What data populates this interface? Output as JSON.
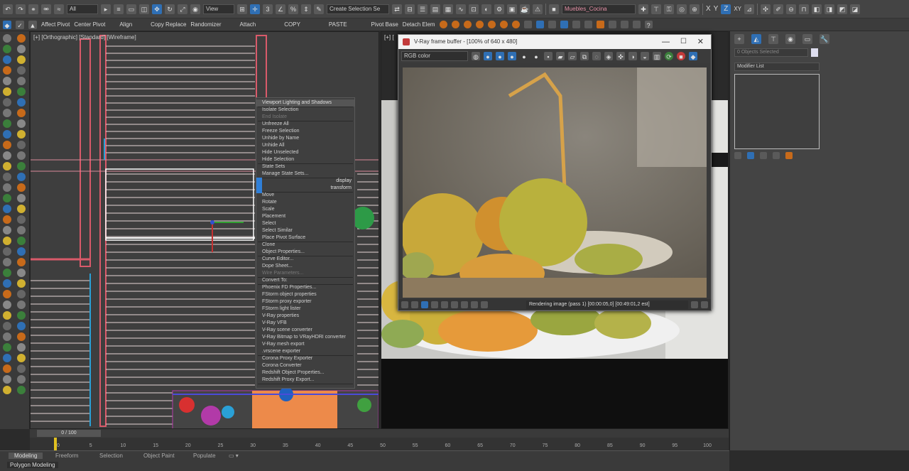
{
  "toolbar": {
    "filter_value": "All",
    "view_value": "View",
    "selection_set_placeholder": "Create Selection Se",
    "object_name": "Muebles_Cocina",
    "axis_labels": [
      "X",
      "Y",
      "Z",
      "XY"
    ]
  },
  "toolbar2": {
    "items": [
      "Affect Pivot",
      "Center Pivot",
      "Align",
      "Copy Replace",
      "Randomizer",
      "Attach",
      "COPY",
      "PASTE",
      "Pivot Base",
      "Detach Elem"
    ]
  },
  "viewport_left": {
    "label": "[+] [Orthographic] [Standard] [Wireframe]"
  },
  "viewport_right": {
    "label": "[+] ["
  },
  "quad_menu": {
    "items": [
      {
        "label": "Viewport Lighting and Shadows",
        "type": "head"
      },
      {
        "label": "Isolate Selection",
        "type": "item"
      },
      {
        "label": "End Isolate",
        "type": "dim"
      },
      {
        "label": "Unfreeze All",
        "type": "item"
      },
      {
        "label": "Freeze Selection",
        "type": "item"
      },
      {
        "label": "Unhide by Name",
        "type": "item"
      },
      {
        "label": "Unhide All",
        "type": "item"
      },
      {
        "label": "Hide Unselected",
        "type": "item"
      },
      {
        "label": "Hide Selection",
        "type": "item"
      },
      {
        "label": "State Sets",
        "type": "item"
      },
      {
        "label": "Manage State Sets...",
        "type": "item"
      },
      {
        "label": "display",
        "type": "right"
      },
      {
        "label": "transform",
        "type": "right"
      },
      {
        "label": "Move",
        "type": "item"
      },
      {
        "label": "Rotate",
        "type": "item"
      },
      {
        "label": "Scale",
        "type": "item"
      },
      {
        "label": "Placement",
        "type": "item"
      },
      {
        "label": "Select",
        "type": "item"
      },
      {
        "label": "Select Similar",
        "type": "item"
      },
      {
        "label": "Place Pivot Surface",
        "type": "item"
      },
      {
        "label": "Clone",
        "type": "item"
      },
      {
        "label": "Object Properties...",
        "type": "item"
      },
      {
        "label": "Curve Editor...",
        "type": "item"
      },
      {
        "label": "Dope Sheet...",
        "type": "item"
      },
      {
        "label": "Wire Parameters...",
        "type": "dim"
      },
      {
        "label": "Convert To:",
        "type": "item"
      },
      {
        "label": "Phoenix FD Properties...",
        "type": "item"
      },
      {
        "label": "FStorm object properties",
        "type": "item"
      },
      {
        "label": "FStorm proxy exporter",
        "type": "item"
      },
      {
        "label": "FStorm light lister",
        "type": "item"
      },
      {
        "label": "V-Ray properties",
        "type": "item"
      },
      {
        "label": "V-Ray VFB",
        "type": "item"
      },
      {
        "label": "V-Ray scene converter",
        "type": "item"
      },
      {
        "label": "V-Ray Bitmap to VRayHDRI converter",
        "type": "item"
      },
      {
        "label": "V-Ray mesh export",
        "type": "item"
      },
      {
        "label": ".vrscene exporter",
        "type": "item"
      },
      {
        "label": "Corona Proxy Exporter",
        "type": "item"
      },
      {
        "label": "Corona Converter",
        "type": "item"
      },
      {
        "label": "Redshift Object Properties...",
        "type": "item"
      },
      {
        "label": "Redshift Proxy Export...",
        "type": "item"
      }
    ]
  },
  "vfb": {
    "title": "V-Ray frame buffer - [100% of 640 x 480]",
    "channel": "RGB color",
    "status": "Rendering image (pass 1) [00:00:05,0] [00:49:01,2 est]"
  },
  "command_panel": {
    "name_field": "0 Objects Selected",
    "modifier_list": "Modifier List"
  },
  "timeline": {
    "frame_display": "0 / 100",
    "ticks": [
      "0",
      "5",
      "10",
      "15",
      "20",
      "25",
      "30",
      "35",
      "40",
      "45",
      "50",
      "55",
      "60",
      "65",
      "70",
      "75",
      "80",
      "85",
      "90",
      "95",
      "100"
    ]
  },
  "ribbon": {
    "tabs": [
      "Modeling",
      "Freeform",
      "Selection",
      "Object Paint",
      "Populate"
    ],
    "sublabel": "Polygon Modeling"
  }
}
